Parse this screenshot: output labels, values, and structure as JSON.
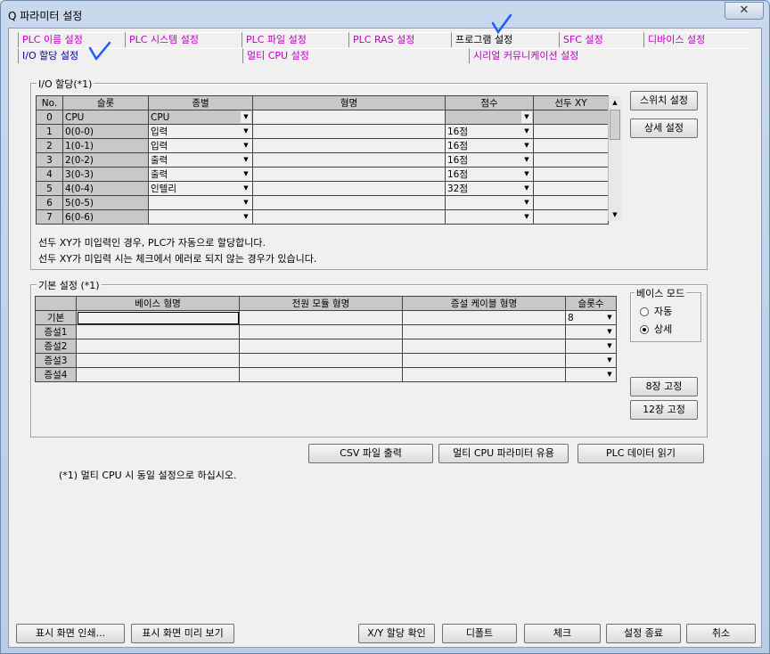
{
  "window": {
    "title": "Q 파라미터 설정",
    "close_label": "✕"
  },
  "tabs": {
    "row1": [
      "PLC 이름 설정",
      "PLC 시스템 설정",
      "PLC 파일 설정",
      "PLC RAS 설정",
      "프로그램 설정",
      "SFC 설정",
      "디바이스 설정"
    ],
    "row2": [
      "I/O 할당 설정",
      "멀티 CPU 설정",
      "시리얼 커뮤니케이션 설정"
    ]
  },
  "io": {
    "group_label": "I/O 할당(*1)",
    "headers": [
      "No.",
      "슬롯",
      "종별",
      "형명",
      "점수",
      "선두 XY"
    ],
    "rows": [
      {
        "no": "0",
        "slot": "CPU",
        "type": "CPU",
        "model": "",
        "points": "",
        "xy": ""
      },
      {
        "no": "1",
        "slot": "0(0-0)",
        "type": "입력",
        "model": "",
        "points": "16점",
        "xy": ""
      },
      {
        "no": "2",
        "slot": "1(0-1)",
        "type": "입력",
        "model": "",
        "points": "16점",
        "xy": ""
      },
      {
        "no": "3",
        "slot": "2(0-2)",
        "type": "출력",
        "model": "",
        "points": "16점",
        "xy": ""
      },
      {
        "no": "4",
        "slot": "3(0-3)",
        "type": "출력",
        "model": "",
        "points": "16점",
        "xy": ""
      },
      {
        "no": "5",
        "slot": "4(0-4)",
        "type": "인텔리",
        "model": "",
        "points": "32점",
        "xy": ""
      },
      {
        "no": "6",
        "slot": "5(0-5)",
        "type": "",
        "model": "",
        "points": "",
        "xy": ""
      },
      {
        "no": "7",
        "slot": "6(0-6)",
        "type": "",
        "model": "",
        "points": "",
        "xy": ""
      }
    ],
    "switch_button": "스위치 설정",
    "detail_button": "상세 설정",
    "note1": "선두 XY가 미입력인 경우, PLC가 자동으로 할당합니다.",
    "note2": "선두 XY가 미입력 시는 체크에서 에러로 되지 않는 경우가 있습니다."
  },
  "base": {
    "group_label": "기본 설정 (*1)",
    "headers": [
      "",
      "베이스 형명",
      "전원 모듈 형명",
      "증설 케이블 형명",
      "슬롯수"
    ],
    "rows": [
      {
        "label": "기본",
        "slots": "8"
      },
      {
        "label": "증설1",
        "slots": ""
      },
      {
        "label": "증설2",
        "slots": ""
      },
      {
        "label": "증설3",
        "slots": ""
      },
      {
        "label": "증설4",
        "slots": ""
      }
    ],
    "mode_label": "베이스 모드",
    "mode_auto": "자동",
    "mode_detail": "상세",
    "fix8_button": "8장 고정",
    "fix12_button": "12장 고정"
  },
  "actions": {
    "csv_button": "CSV 파일 출력",
    "multi_cpu_button": "멀티 CPU 파라미터 유용",
    "read_plc_button": "PLC 데이터 읽기",
    "footnote": "(*1) 멀티 CPU 시 동일 설정으로 하십시오."
  },
  "bottom": {
    "print_button": "표시 화면 인쇄...",
    "preview_button": "표시 화면 미리 보기",
    "xy_check_button": "X/Y 할당 확인",
    "default_button": "디폴트",
    "check_button": "체크",
    "finish_button": "설정 종료",
    "cancel_button": "취소"
  },
  "colors": {
    "tab_text": "#c000c0",
    "annotation": "#1a5cff"
  }
}
